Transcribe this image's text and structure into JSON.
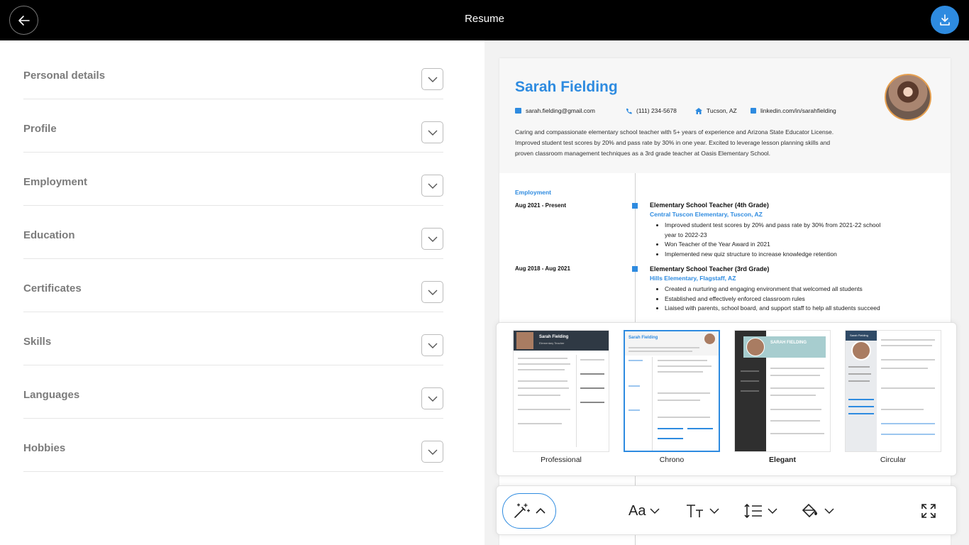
{
  "header": {
    "title": "Resume"
  },
  "sections": [
    {
      "label": "Personal details"
    },
    {
      "label": "Profile"
    },
    {
      "label": "Employment"
    },
    {
      "label": "Education"
    },
    {
      "label": "Certificates"
    },
    {
      "label": "Skills"
    },
    {
      "label": "Languages"
    },
    {
      "label": "Hobbies"
    }
  ],
  "resume": {
    "name": "Sarah Fielding",
    "email": "sarah.fielding@gmail.com",
    "phone": "(111) 234-5678",
    "location": "Tucson, AZ",
    "linkedin": "linkedin.com/in/sarahfielding",
    "summary": "Caring and compassionate elementary school teacher with 5+ years of experience and Arizona State Educator License. Improved student test scores by 20% and pass rate by 30% in one year. Excited to leverage lesson planning skills and proven classroom management techniques as a 3rd grade teacher at Oasis Elementary School.",
    "employment_title": "Employment",
    "jobs": [
      {
        "dates": "Aug 2021 - Present",
        "title": "Elementary School Teacher (4th Grade)",
        "place": "Central Tuscon Elementary, Tuscon, AZ",
        "bullets": [
          "Improved student test scores by 20% and pass rate by 30% from 2021-22 school year to 2022-23",
          "Won Teacher of the Year Award in 2021",
          "Implemented new quiz structure to increase knowledge retention"
        ]
      },
      {
        "dates": "Aug 2018 - Aug 2021",
        "title": "Elementary School Teacher (3rd Grade)",
        "place": "Hills Elementary, Flagstaff, AZ",
        "bullets": [
          "Created a nurturing and engaging environment that welcomed all students",
          "Established and effectively enforced classroom rules",
          "Liaised with parents, school board, and support staff to help all students succeed"
        ]
      }
    ]
  },
  "templates": [
    {
      "label": "Professional",
      "thumb_name": "Sarah Fielding",
      "thumb_subtitle": "Elementary Teacher"
    },
    {
      "label": "Chrono",
      "thumb_name": "Sarah Fielding"
    },
    {
      "label": "Elegant",
      "thumb_name": "SARAH FIELDING"
    },
    {
      "label": "Circular",
      "thumb_name": "Sarah Fielding"
    }
  ],
  "toolbar": {
    "font_label": "Aa"
  },
  "colors": {
    "accent": "#2e8be0",
    "topbar": "#000000",
    "label_gray": "#7b7b7b"
  }
}
